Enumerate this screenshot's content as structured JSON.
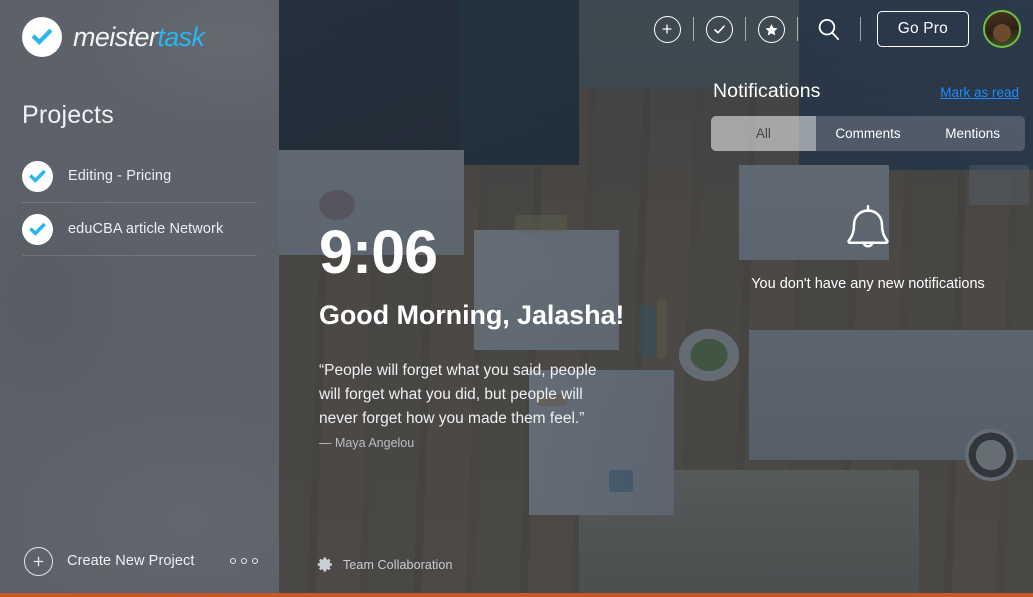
{
  "brand": {
    "name_part1": "meister",
    "name_part2": "task",
    "logo_icon": "check-circle-icon",
    "accent_color": "#29b6f0"
  },
  "sidebar": {
    "projects_heading": "Projects",
    "projects": [
      {
        "label": "Editing - Pricing",
        "icon": "check-circle-icon"
      },
      {
        "label": "eduCBA article Network",
        "icon": "check-circle-icon"
      }
    ],
    "footer": {
      "create_label": "Create New Project",
      "create_icon": "plus-circle-icon",
      "more_icon": "three-dots-icon"
    }
  },
  "toolbar": {
    "items": [
      {
        "icon": "plus-circle-icon",
        "name": "add-button"
      },
      {
        "icon": "check-circle-icon",
        "name": "tasks-button"
      },
      {
        "icon": "star-circle-icon",
        "name": "favorites-button"
      },
      {
        "icon": "search-icon",
        "name": "search-button"
      }
    ],
    "go_pro_label": "Go Pro",
    "avatar_icon": "user-avatar",
    "avatar_status_color": "#72c043"
  },
  "notifications": {
    "title": "Notifications",
    "mark_as_read": "Mark as read",
    "mark_as_read_color": "#1f8bff",
    "tabs": [
      {
        "label": "All",
        "active": true
      },
      {
        "label": "Comments",
        "active": false
      },
      {
        "label": "Mentions",
        "active": false
      }
    ],
    "empty_icon": "bell-icon",
    "empty_message": "You don't have any new notifications"
  },
  "greeting": {
    "time": "9:06",
    "salutation": "Good Morning, Jalasha!",
    "quote": "“People will forget what you said, people will forget what you did, but people will never forget how you made them feel.”",
    "quote_author": "— Maya Angelou"
  },
  "status_bar": {
    "icon": "gear-icon",
    "label": "Team Collaboration"
  },
  "theme": {
    "sidebar_bg": "#5d6169",
    "overlay": "rgba(44,55,68,0.72)",
    "bottom_border": "#c8562a"
  }
}
